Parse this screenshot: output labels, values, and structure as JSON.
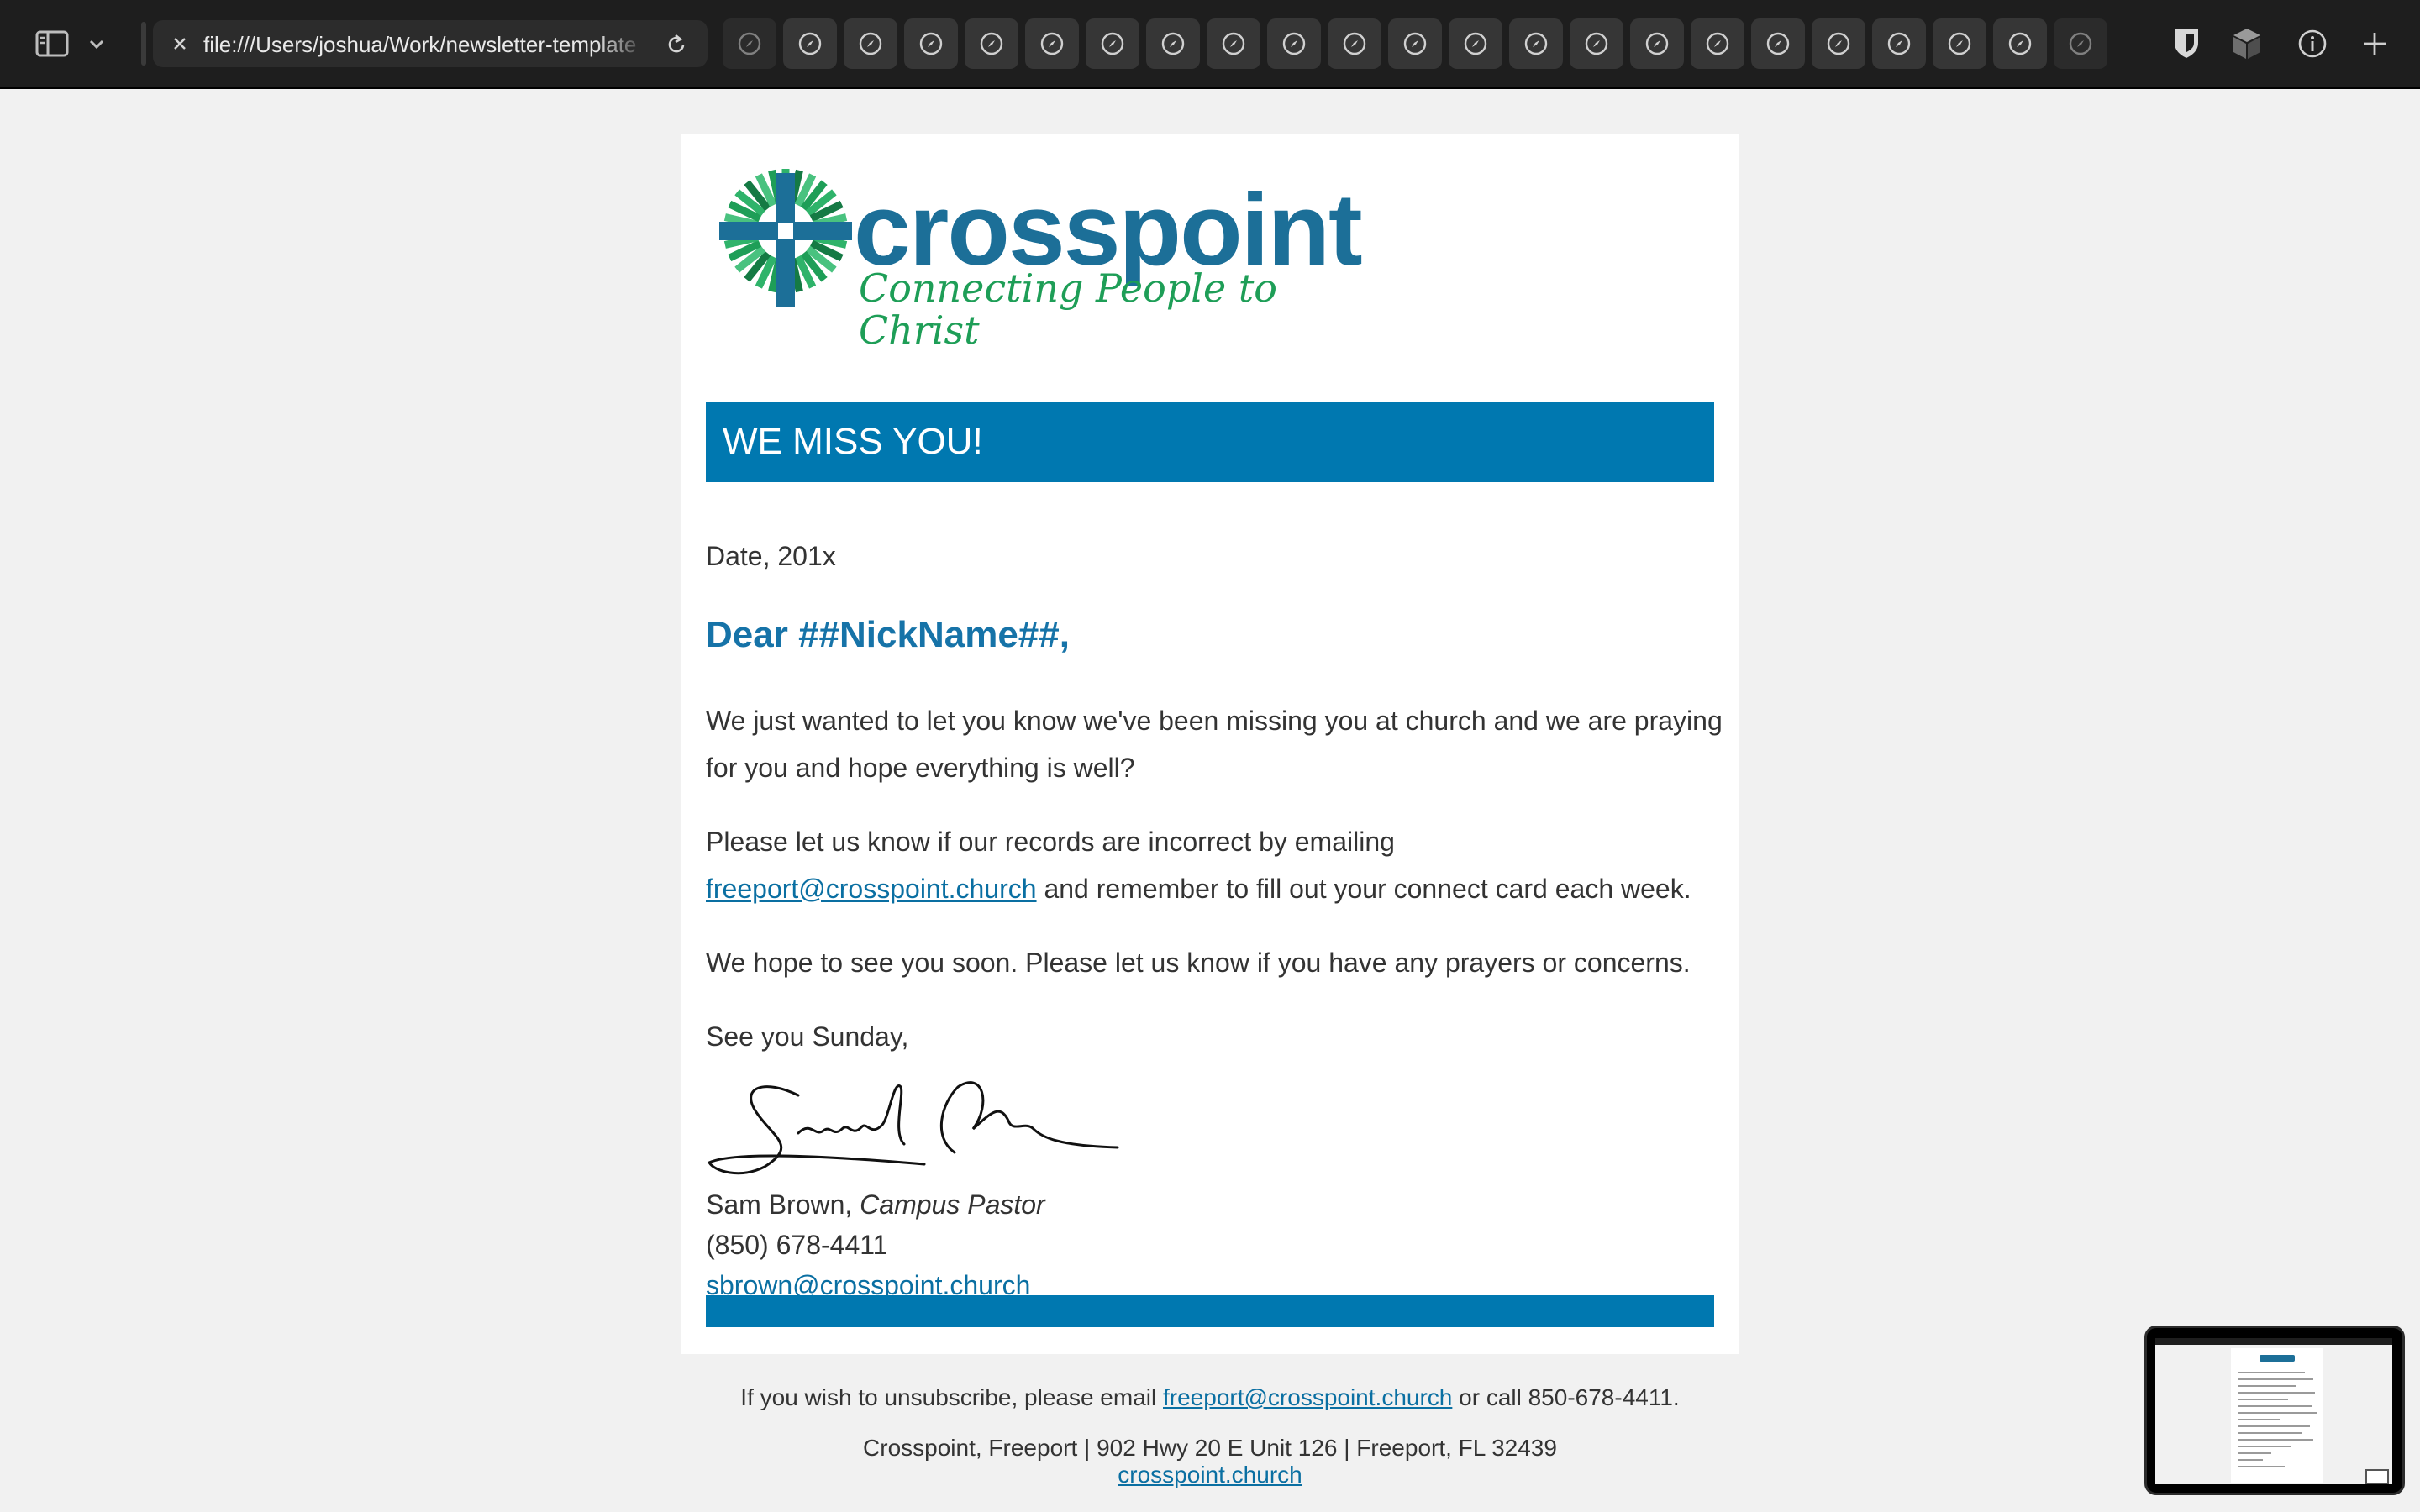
{
  "browser": {
    "url": "file:///Users/joshua/Work/newsletter-template",
    "tab_count": 23
  },
  "email": {
    "logo": {
      "brand": "crosspoint",
      "tagline": "Connecting People to Christ"
    },
    "banner_title": "WE MISS YOU!",
    "date": "Date, 201x",
    "greeting": "Dear ##NickName##,",
    "paragraph1": "We just wanted to let you know we've been missing you at church and we are praying for you and hope everything is well?",
    "paragraph2_before": "Please let us know if our records are incorrect by emailing",
    "paragraph2_link": "freeport@crosspoint.church",
    "paragraph2_after": " and remember to fill out your connect card each week.",
    "paragraph3": "We hope to see you soon. Please let us know if you have any prayers or concerns.",
    "closing": "See you Sunday,",
    "signer_name": "Sam Brown, ",
    "signer_title": "Campus Pastor",
    "signer_phone": "(850) 678-4411",
    "signer_email": "sbrown@crosspoint.church"
  },
  "footer": {
    "unsub_before": "If you wish to unsubscribe, please email ",
    "unsub_link": "freeport@crosspoint.church",
    "unsub_after": " or call 850-678-4411.",
    "address": "Crosspoint, Freeport | 902 Hwy 20 E Unit 126 | Freeport, FL 32439",
    "website": "crosspoint.church"
  },
  "colors": {
    "brand_blue": "#0078b0",
    "brand_green": "#1e9e57",
    "link": "#0a6fa2",
    "toolbar": "#1e1e1e"
  },
  "icons": [
    "sidebar-icon",
    "chevron-down-icon",
    "close-icon",
    "reload-icon",
    "compass-icon",
    "shield-icon",
    "box-icon",
    "info-icon",
    "plus-icon"
  ]
}
